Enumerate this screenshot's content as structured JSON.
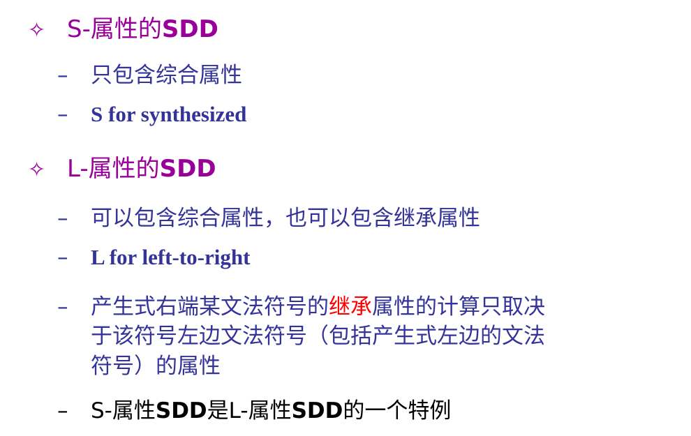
{
  "outline": {
    "section1": {
      "marker": "✧",
      "prefix": "S-属性的",
      "bold": "SDD",
      "items": [
        {
          "dash": "–",
          "text": "只包含综合属性"
        },
        {
          "dash": "–",
          "text": "S for synthesized"
        }
      ]
    },
    "section2": {
      "marker": "✧",
      "prefix": "L-属性的",
      "bold": "SDD",
      "items": [
        {
          "dash": "–",
          "text": "可以包含综合属性，也可以包含继承属性"
        },
        {
          "dash": "–",
          "text": "L for left-to-right"
        },
        {
          "dash": "–",
          "line1_before": "产生式右端某文法符号的",
          "line1_highlight": "继承",
          "line1_after": "属性的计算只取决",
          "line2": "于该符号左边文法符号（包括产生式左边的文法",
          "line3": "符号）的属性"
        },
        {
          "dash": "–",
          "p1": "S-属性",
          "p2": "SDD",
          "p3": "是L-属性",
          "p4": "SDD",
          "p5": "的一个特例"
        }
      ]
    }
  },
  "colors": {
    "heading": "#990099",
    "body": "#333399",
    "highlight": "#ff0000",
    "last": "#000000"
  }
}
